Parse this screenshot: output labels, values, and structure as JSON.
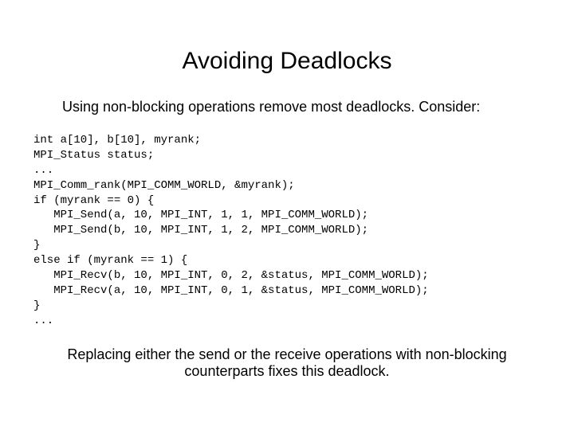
{
  "title": "Avoiding Deadlocks",
  "intro": "Using non-blocking operations remove most deadlocks. Consider:",
  "code": "int a[10], b[10], myrank;\nMPI_Status status;\n...\nMPI_Comm_rank(MPI_COMM_WORLD, &myrank);\nif (myrank == 0) {\n   MPI_Send(a, 10, MPI_INT, 1, 1, MPI_COMM_WORLD);\n   MPI_Send(b, 10, MPI_INT, 1, 2, MPI_COMM_WORLD);\n}\nelse if (myrank == 1) {\n   MPI_Recv(b, 10, MPI_INT, 0, 2, &status, MPI_COMM_WORLD);\n   MPI_Recv(a, 10, MPI_INT, 0, 1, &status, MPI_COMM_WORLD);\n}\n...",
  "outro": "Replacing either the send or the receive operations with non-blocking counterparts fixes this deadlock."
}
